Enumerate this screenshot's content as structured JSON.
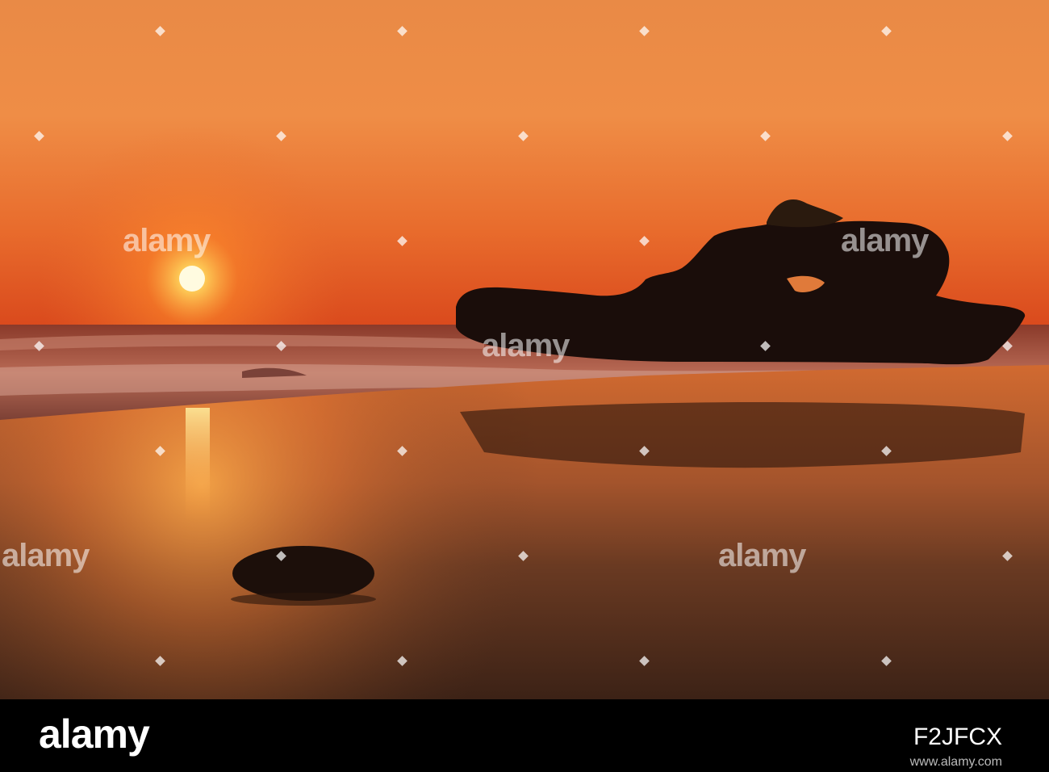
{
  "watermark": {
    "brand": "alamy",
    "image_id": "F2JFCX",
    "site": "www.alamy.com"
  }
}
